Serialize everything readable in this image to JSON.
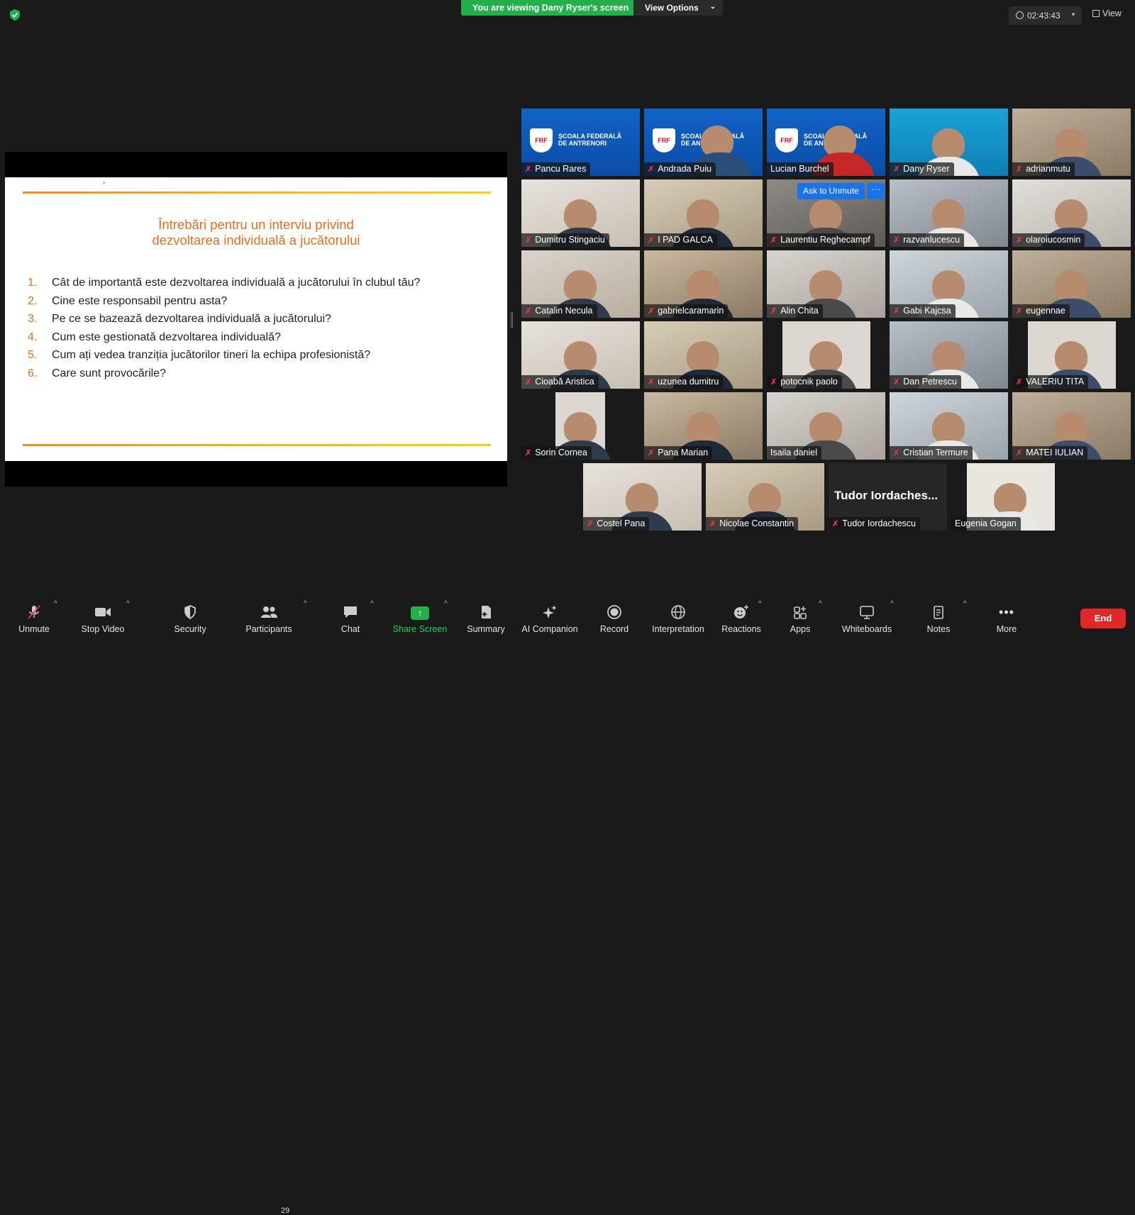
{
  "top": {
    "banner": "You are viewing Dany Ryser's screen",
    "view_options": "View Options",
    "timer": "02:43:43",
    "view": "View"
  },
  "slide": {
    "title_line1": "Întrebări pentru un interviu privind",
    "title_line2": "dezvoltarea individuală a jucătorului",
    "mark": "›",
    "items": [
      {
        "num": "1.",
        "text": "Cât de importantă este dezvoltarea individuală a jucătorului în clubul tău?"
      },
      {
        "num": "2.",
        "text": "Cine este responsabil pentru asta?"
      },
      {
        "num": "3.",
        "text": "Pe ce se bazează dezvoltarea individuală a jucătorului?"
      },
      {
        "num": "4.",
        "text": "Cum este gestionată dezvoltarea individuală?"
      },
      {
        "num": "5.",
        "text": "Cum ați vedea tranziția jucătorilor tineri la echipa profesionistă?"
      },
      {
        "num": "6.",
        "text": "Care sunt provocările?"
      }
    ]
  },
  "frf": {
    "line1": "ȘCOALA FEDERALĂ",
    "line2": "DE ANTRENORI",
    "logo": "FRF"
  },
  "participants": [
    {
      "name": "Pancu Rares",
      "muted": true
    },
    {
      "name": "Andrada Puiu",
      "muted": true
    },
    {
      "name": "Lucian Burchel",
      "muted": false
    },
    {
      "name": "Dany Ryser",
      "muted": true
    },
    {
      "name": "adrianmutu",
      "muted": true
    },
    {
      "name": "Dumitru Stingaciu",
      "muted": true
    },
    {
      "name": "I PAD GALCA",
      "muted": true
    },
    {
      "name": "Laurentiu Reghecampf",
      "muted": true
    },
    {
      "name": "razvanlucescu",
      "muted": true
    },
    {
      "name": "olaroiucosmin",
      "muted": true
    },
    {
      "name": "Catalin Necula",
      "muted": true
    },
    {
      "name": "gabrielcaramarin",
      "muted": true
    },
    {
      "name": "Alin Chita",
      "muted": true
    },
    {
      "name": "Gabi Kajcsa",
      "muted": true
    },
    {
      "name": "eugennae",
      "muted": true
    },
    {
      "name": "Cioabă Aristica",
      "muted": true
    },
    {
      "name": "uzunea dumitru",
      "muted": true
    },
    {
      "name": "potocnik paolo",
      "muted": true
    },
    {
      "name": "Dan Petrescu",
      "muted": true
    },
    {
      "name": "VALERIU TITA",
      "muted": true
    },
    {
      "name": "Sorin Cornea",
      "muted": true
    },
    {
      "name": "Pana Marian",
      "muted": true
    },
    {
      "name": "Isaila daniel",
      "muted": false
    },
    {
      "name": "Cristian Termure",
      "muted": true
    },
    {
      "name": "MATEI IULIAN",
      "muted": true
    },
    {
      "name": "Costel Pana",
      "muted": true
    },
    {
      "name": "Nicolae Constantin",
      "muted": true
    },
    {
      "name": "Tudor Iordachescu",
      "muted": true
    },
    {
      "name": "Eugenia Gogan",
      "muted": false
    }
  ],
  "name_only_big": "Tudor Iordaches...",
  "ask_unmute": "Ask to Unmute",
  "toolbar": {
    "unmute": "Unmute",
    "stop_video": "Stop Video",
    "security": "Security",
    "participants": "Participants",
    "participants_count": "29",
    "chat": "Chat",
    "share_screen": "Share Screen",
    "summary": "Summary",
    "ai_companion": "AI Companion",
    "record": "Record",
    "interpretation": "Interpretation",
    "reactions": "Reactions",
    "apps": "Apps",
    "whiteboards": "Whiteboards",
    "notes": "Notes",
    "more": "More",
    "end": "End"
  }
}
